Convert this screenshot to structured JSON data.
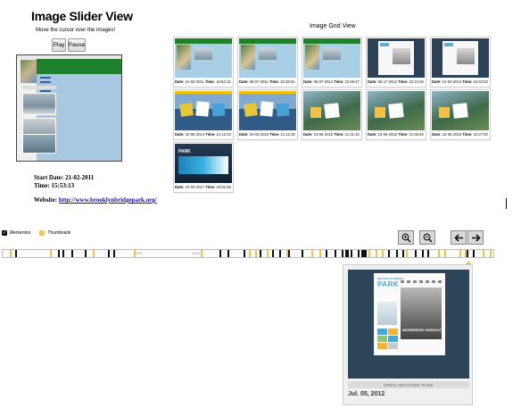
{
  "slider": {
    "title": "Image Slider View",
    "subtitle": "Move the cursor over the images!",
    "play_label": "Play",
    "pause_label": "Pause",
    "start_date_label": "Start Date:",
    "start_date": "21-02-2011",
    "time_label": "Time:",
    "time": "15:53:13",
    "website_label": "Website:",
    "website": "http://www.brooklynbridgepark.org/"
  },
  "grid": {
    "title": "Image Grid View",
    "date_label": "Date:",
    "time_label": "Time:",
    "items": [
      {
        "date": "21-02-2011",
        "time": "15:53:13",
        "style": "old"
      },
      {
        "date": "05-07-2011",
        "time": "22:38:01",
        "style": "old"
      },
      {
        "date": "05-07-2012",
        "time": "22:30:47",
        "style": "old"
      },
      {
        "date": "05-17-2012",
        "time": "22:13:46",
        "style": "navy"
      },
      {
        "date": "12-03-2013",
        "time": "15:42:53",
        "style": "navy"
      },
      {
        "date": "10-05-2014",
        "time": "21:12:43",
        "style": "photo"
      },
      {
        "date": "10-03-2015",
        "time": "21:12:30",
        "style": "photo"
      },
      {
        "date": "10-05-2015",
        "time": "21:31:42",
        "style": "aerial"
      },
      {
        "date": "10-05-2016",
        "time": "21:45:46",
        "style": "aerial"
      },
      {
        "date": "15-05-2016",
        "time": "22:27:00",
        "style": "aerial"
      },
      {
        "date": "10-03-2017",
        "time": "23:01:55",
        "style": "dark"
      }
    ]
  },
  "timeline": {
    "legend_mementos": "Mementos",
    "legend_thumbnails": "Thumbnails",
    "year_labels": [
      "2007",
      "2009"
    ],
    "zoom_in_icon": "zoom-in-icon",
    "zoom_out_icon": "zoom-out-icon",
    "back_icon": "arrow-left-icon",
    "forward_icon": "arrow-right-icon",
    "colors": {
      "memento": "#111111",
      "thumbnail": "#f0c24a"
    }
  },
  "popup": {
    "logo": "PARK",
    "logo_small": "BROOKLYN BRIDGE",
    "hero_text": "WATERFRONT WORKOUTS",
    "open_label": "OPEN ARCHIVED PAGE",
    "date": "Jul. 05, 2012"
  }
}
